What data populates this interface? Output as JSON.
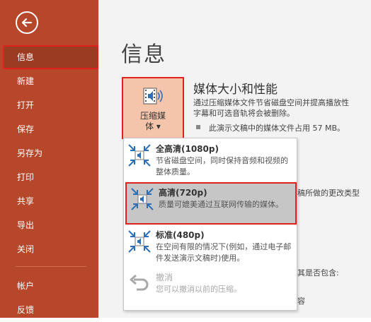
{
  "sidebar": {
    "items": [
      {
        "label": "信息"
      },
      {
        "label": "新建"
      },
      {
        "label": "打开"
      },
      {
        "label": "保存"
      },
      {
        "label": "另存为"
      },
      {
        "label": "打印"
      },
      {
        "label": "共享"
      },
      {
        "label": "导出"
      },
      {
        "label": "关闭"
      },
      {
        "label": "帐户"
      },
      {
        "label": "反馈"
      }
    ]
  },
  "main": {
    "title": "信息",
    "compress_button": {
      "line1": "压缩媒",
      "line2": "体 ▾"
    },
    "media": {
      "title": "媒体大小和性能",
      "desc_line1": "通过压缩媒体文件节省磁盘空间并提高播放性",
      "desc_line2": "字幕和可选音轨将会被删除。",
      "size_text": "此演示文稿中的媒体文件占用 57 MB。"
    },
    "bg_fragments": {
      "frag1": "稿所做的更改类型",
      "frag2": "其是否包含:",
      "frag3": "容"
    }
  },
  "dropdown": {
    "options": [
      {
        "title": "全高清(1080p)",
        "desc": "节省磁盘空间，同时保持音频和视频的整体质量。"
      },
      {
        "title": "高清(720p)",
        "desc": "质量可媲美通过互联网传输的媒体。"
      },
      {
        "title": "标准(480p)",
        "desc": "在空间有限的情况下(例如，通过电子邮件发送演示文稿时)使用。"
      },
      {
        "title": "撤消",
        "desc": "您可以撤消以前的压缩。"
      }
    ]
  },
  "colors": {
    "sidebar_bg": "#b7472a",
    "active_item_bg": "#9b3b22",
    "highlight_border": "#e0221f",
    "button_bg": "#f5c5ab",
    "selected_option_bg": "#c6c6c6",
    "icon_blue": "#2c6fb7"
  }
}
